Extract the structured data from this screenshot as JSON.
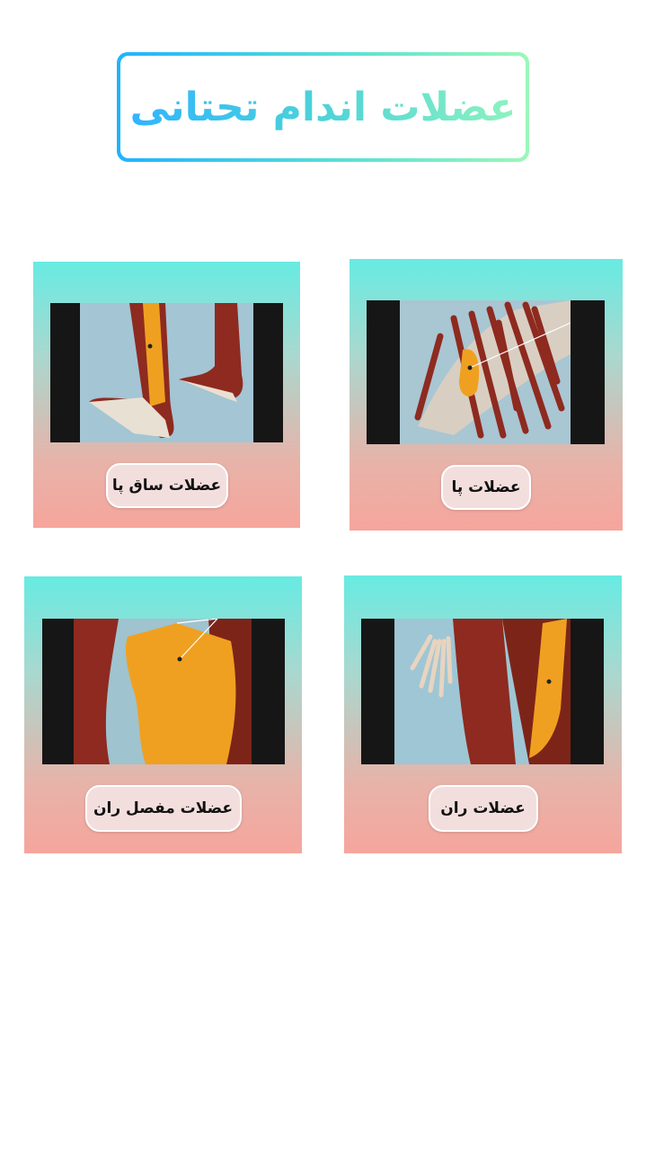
{
  "header": {
    "title": "عضلات اندام تحتانی"
  },
  "cards": [
    {
      "label": "عضلات پا",
      "image": "foot-muscles-image"
    },
    {
      "label": "عضلات ساق پا",
      "image": "leg-muscles-image"
    },
    {
      "label": "عضلات ران",
      "image": "thigh-muscles-image"
    },
    {
      "label": "عضلات مفصل ران",
      "image": "hip-muscles-image"
    }
  ],
  "colors": {
    "gradient_top": "#67ebe2",
    "gradient_bottom": "#f6a59c",
    "title_gradient_start": "#1fb3ff",
    "title_gradient_end": "#9bf7b8",
    "muscle_red": "#8e2a1f",
    "muscle_highlight": "#f0a020",
    "image_background": "#9fc6d4"
  }
}
